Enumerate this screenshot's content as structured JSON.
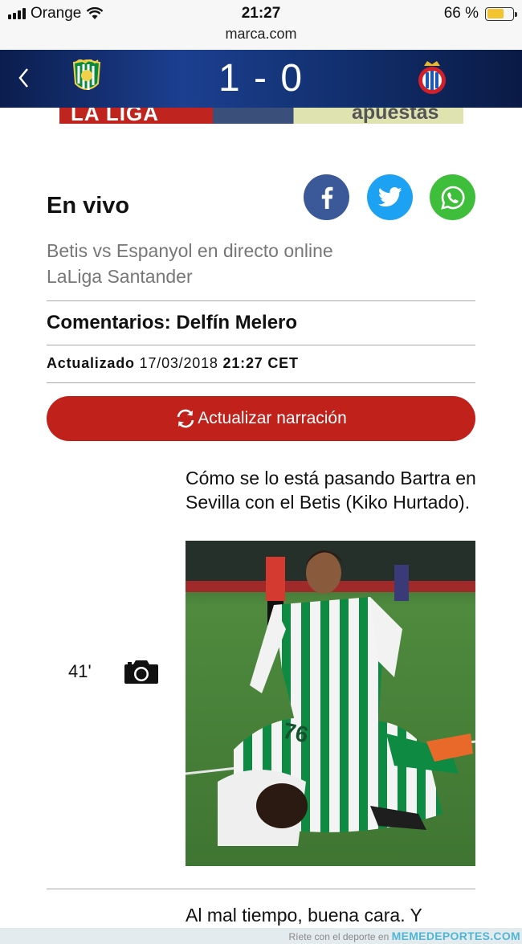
{
  "status_bar": {
    "carrier": "Orange",
    "time": "21:27",
    "url": "marca.com",
    "battery_percent": "66 %",
    "battery_level": 0.66
  },
  "match_header": {
    "score": "1 - 0",
    "home_crest_icon": "betis-crest-icon",
    "away_crest_icon": "espanyol-crest-icon"
  },
  "ad": {
    "left_text": "LA LIGA",
    "right_text": "apuestas"
  },
  "live": {
    "title": "En vivo",
    "share": [
      "facebook-icon",
      "twitter-icon",
      "whatsapp-icon"
    ],
    "match_title_line1": "Betis vs Espanyol en directo online",
    "match_title_line2": "LaLiga Santander",
    "commentary": "Comentarios: Delfín Melero",
    "updated_label": "Actualizado",
    "updated_date": "17/03/2018",
    "updated_time": "21:27 CET",
    "refresh_label": "Actualizar narración"
  },
  "narration": [
    {
      "minute": "41'",
      "icon": "camera-icon",
      "text": "Cómo se lo está pasando Bartra en Sevilla con el Betis (Kiko Hurtado)."
    },
    {
      "text": "Al mal tiempo, buena cara. Y"
    }
  ],
  "watermark": {
    "text": "Ríete con el deporte en",
    "brand": "MEMEDEPORTES.COM"
  },
  "colors": {
    "accent_red": "#c0211b",
    "facebook": "#3b5998",
    "twitter": "#1da1f2",
    "whatsapp": "#3fbe3c",
    "header_blue": "#1c3f8f"
  }
}
